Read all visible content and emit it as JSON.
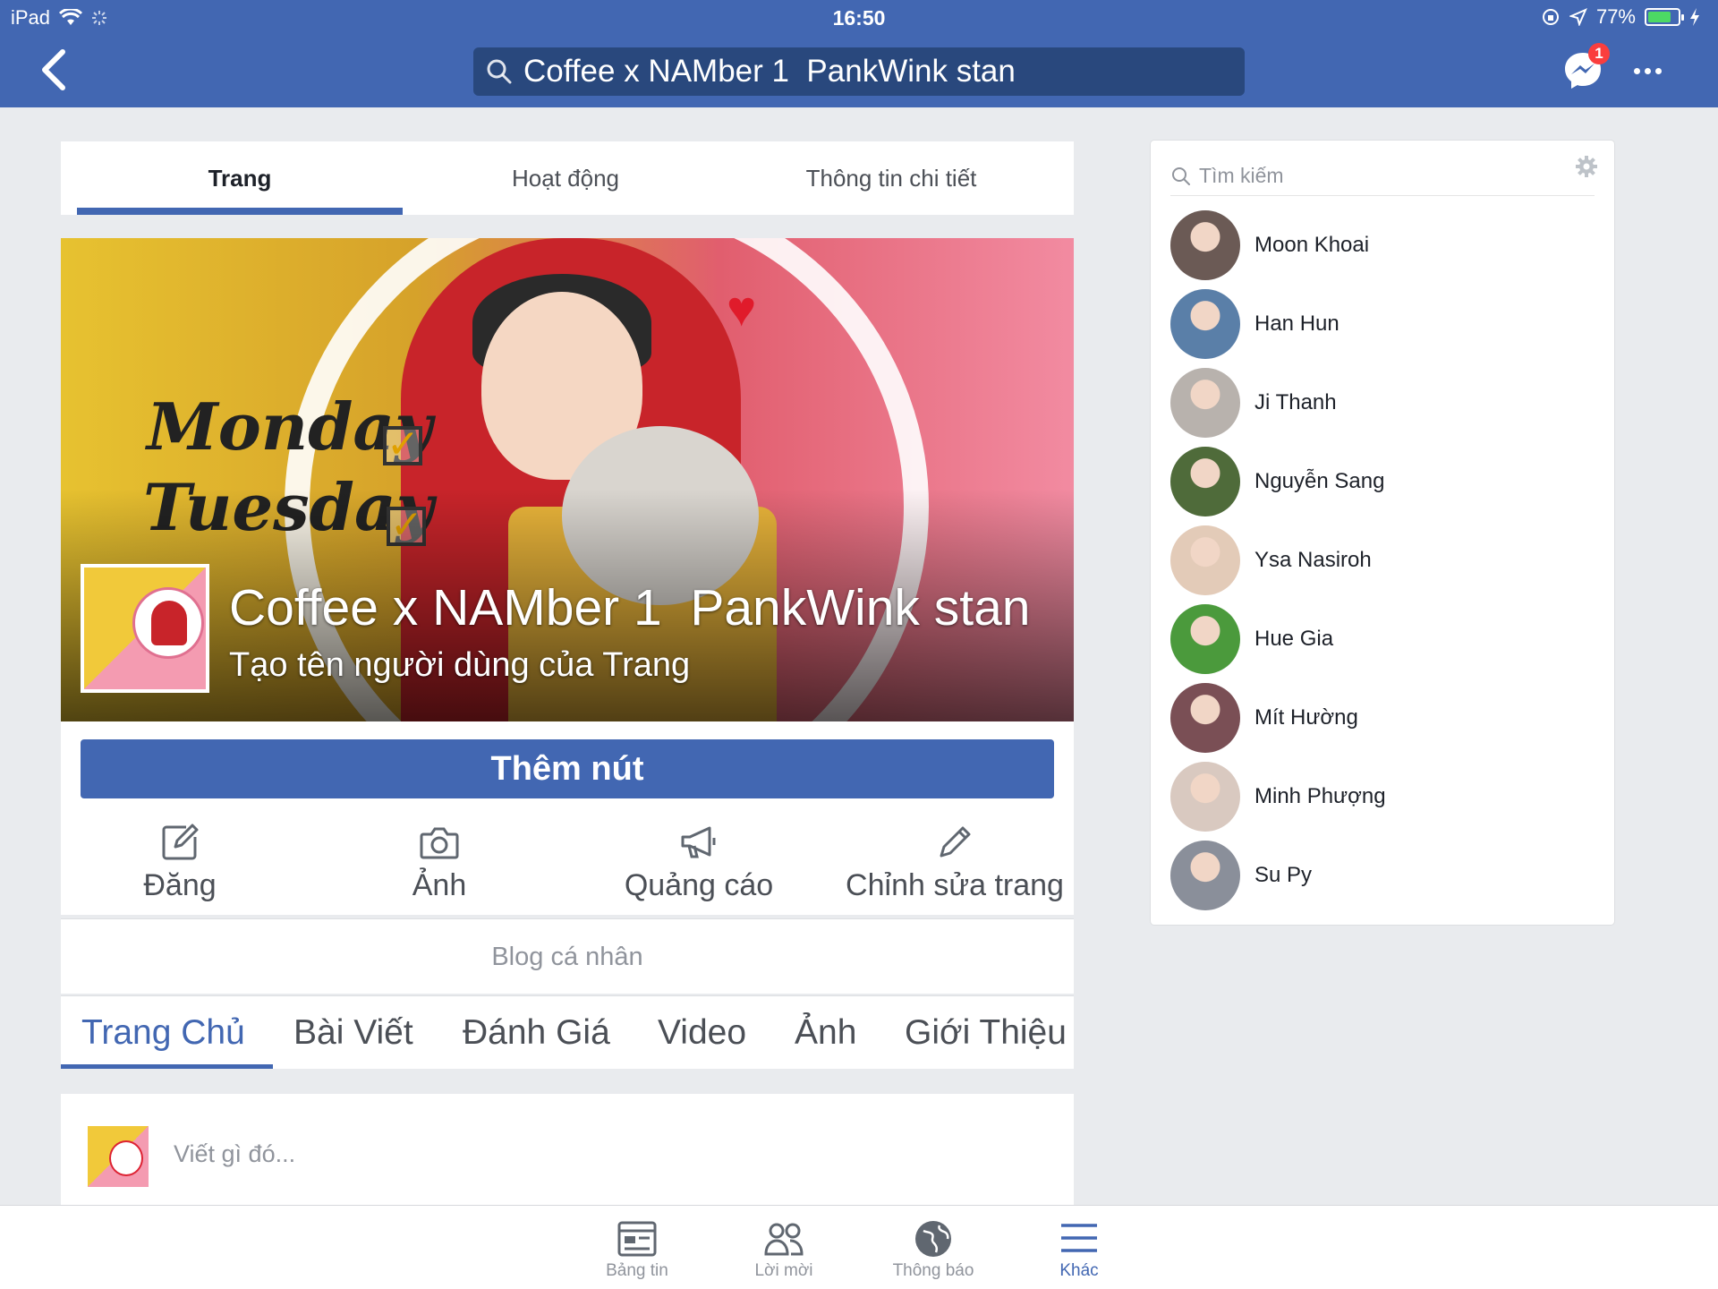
{
  "status_bar": {
    "device": "iPad",
    "time": "16:50",
    "battery": "77%",
    "battery_level": 0.77
  },
  "header": {
    "search_text": "Coffee x NAMber 1  PankWink stan",
    "messenger_badge": "1"
  },
  "page_tabs": [
    {
      "label": "Trang",
      "active": true
    },
    {
      "label": "Hoạt động",
      "active": false
    },
    {
      "label": "Thông tin chi tiết",
      "active": false
    }
  ],
  "cover": {
    "page_name": "Coffee x NAMber 1  PankWink stan",
    "username_prompt": "Tạo tên người dùng của Trang",
    "deco_words": [
      "Monday",
      "Tuesday"
    ]
  },
  "add_button_label": "Thêm nút",
  "actions": [
    {
      "label": "Đăng",
      "icon": "compose-icon"
    },
    {
      "label": "Ảnh",
      "icon": "camera-icon"
    },
    {
      "label": "Quảng cáo",
      "icon": "megaphone-icon"
    },
    {
      "label": "Chỉnh sửa trang",
      "icon": "pencil-icon"
    }
  ],
  "category": "Blog cá nhân",
  "section_tabs": [
    {
      "label": "Trang Chủ",
      "active": true
    },
    {
      "label": "Bài Viết",
      "active": false
    },
    {
      "label": "Đánh Giá",
      "active": false
    },
    {
      "label": "Video",
      "active": false
    },
    {
      "label": "Ảnh",
      "active": false
    },
    {
      "label": "Giới Thiệu",
      "active": false
    }
  ],
  "composer_placeholder": "Viết gì đó...",
  "contacts": {
    "search_placeholder": "Tìm kiếm",
    "list": [
      {
        "name": "Moon Khoai",
        "avatar_color": "#6b5a55"
      },
      {
        "name": "Han Hun",
        "avatar_color": "#5a7fa8"
      },
      {
        "name": "Ji Thanh",
        "avatar_color": "#b8b2ad"
      },
      {
        "name": "Nguyễn Sang",
        "avatar_color": "#4f6b3a"
      },
      {
        "name": "Ysa Nasiroh",
        "avatar_color": "#e3cbb8"
      },
      {
        "name": "Hue Gia",
        "avatar_color": "#4b9a3c"
      },
      {
        "name": "Mít Hường",
        "avatar_color": "#7a4f55"
      },
      {
        "name": "Minh Phượng",
        "avatar_color": "#d9c9c0"
      },
      {
        "name": "Su Py",
        "avatar_color": "#8a8f9a"
      }
    ]
  },
  "bottom_tabs": [
    {
      "label": "Bảng tin",
      "icon": "news-feed-icon",
      "active": false
    },
    {
      "label": "Lời mời",
      "icon": "friends-icon",
      "active": false
    },
    {
      "label": "Thông báo",
      "icon": "globe-icon",
      "active": false
    },
    {
      "label": "Khác",
      "icon": "menu-icon",
      "active": true
    }
  ],
  "colors": {
    "brand_blue": "#4267b2",
    "search_bg": "#29487d",
    "badge_red": "#fa3e3e"
  }
}
